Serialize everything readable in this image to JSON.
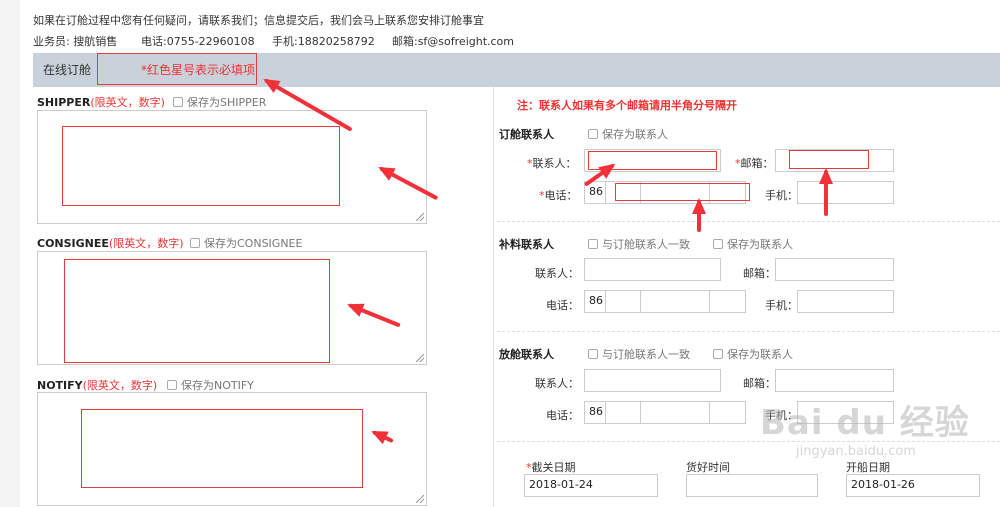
{
  "info": {
    "notice": "如果在订舱过程中您有任何疑问，请联系我们；信息提交后，我们会马上联系您安排订舱事宜",
    "salesperson": "业务员: 搜航销售",
    "phone": "电话:0755-22960108",
    "mobile": "手机:18820258792",
    "email": "邮箱:sf@sofreight.com"
  },
  "header": {
    "title": "在线订舱",
    "required_hint": "*红色星号表示必填项"
  },
  "shipper": {
    "label": "SHIPPER",
    "restrict": "(限英文，数字)",
    "save_label": "保存为SHIPPER"
  },
  "consignee": {
    "label": "CONSIGNEE",
    "restrict": "(限英文，数字)",
    "save_label": "保存为CONSIGNEE"
  },
  "notify": {
    "label": "NOTIFY",
    "restrict": "(限英文，数字)",
    "save_label": "保存为NOTIFY"
  },
  "note": "注：联系人如果有多个邮箱请用半角分号隔开",
  "booking_contact": {
    "title": "订舱联系人",
    "save_label": "保存为联系人",
    "name_label": "联系人：",
    "email_label": "邮箱：",
    "phone_label": "电话：",
    "mobile_label": "手机：",
    "country_code": "86"
  },
  "supplement_contact": {
    "title": "补料联系人",
    "same_label": "与订舱联系人一致",
    "save_label": "保存为联系人",
    "name_label": "联系人：",
    "email_label": "邮箱：",
    "phone_label": "电话：",
    "mobile_label": "手机：",
    "country_code": "86"
  },
  "release_contact": {
    "title": "放舱联系人",
    "same_label": "与订舱联系人一致",
    "save_label": "保存为联系人",
    "name_label": "联系人：",
    "email_label": "邮箱：",
    "phone_label": "电话：",
    "mobile_label": "手机：",
    "country_code": "86"
  },
  "dates": {
    "cutoff_label": "截关日期",
    "cutoff_value": "2018-01-24",
    "cargo_ready_label": "货好时间",
    "cargo_ready_value": "",
    "sailing_label": "开船日期",
    "sailing_value": "2018-01-26"
  },
  "watermark": {
    "logo": "Bai du 经验",
    "sub": "jingyan.baidu.com"
  },
  "colors": {
    "accent_red": "#e63b3b",
    "header_bg": "#c9d1da"
  }
}
